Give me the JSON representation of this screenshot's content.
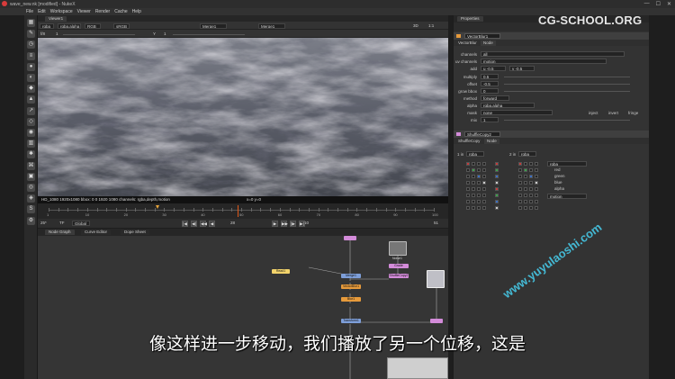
{
  "window": {
    "title": "wave_new.nk [modified] - NukeX",
    "buttons": {
      "minimize": "—",
      "maximize": "☐",
      "close": "✕"
    }
  },
  "menu": [
    "File",
    "Edit",
    "Workspace",
    "Viewer",
    "Render",
    "Cache",
    "Help"
  ],
  "left_toolbar": {
    "icons": [
      "image-icon",
      "draw-icon",
      "time-icon",
      "channel-icon",
      "color-icon",
      "filter-icon",
      "keyer-icon",
      "merge-icon",
      "transform-icon",
      "3d-icon",
      "views-icon",
      "metadata-icon",
      "toolsets-icon",
      "other-icon",
      "furnace-icon",
      "ocula-icon",
      "cara-icon",
      "python-icon",
      "settings-icon"
    ],
    "glyphs": [
      "▦",
      "✎",
      "◷",
      "≡",
      "●",
      "◐",
      "◆",
      "▲",
      "↗",
      "◇",
      "◉",
      "▥",
      "✱",
      "⌘",
      "▣",
      "◎",
      "◈",
      "S",
      "⚙"
    ]
  },
  "viewer": {
    "tab": "Viewer1",
    "bar1": {
      "layer": "rgba",
      "alpha": "rgba.alpha",
      "channel": "RGB",
      "colorspace": "sRGB",
      "input_a": "Merge1",
      "input_b": "Merge1",
      "zoom": "3D",
      "fps": "1:1"
    },
    "bar2": {
      "f": "f/8",
      "gain_value": "1",
      "y": "Y",
      "gamma_value": "1"
    },
    "info": {
      "format": "HD_1080 1920x1080  bbox: 0 0 1920 1080  channels: rgba,depth,motion",
      "coords": "x=0 y=0"
    }
  },
  "timeline": {
    "start": "1",
    "end": "100",
    "labels": [
      "1",
      "10",
      "20",
      "30",
      "40",
      "50",
      "60",
      "70",
      "80",
      "90",
      "100"
    ],
    "current_frame": "28"
  },
  "playback": {
    "fps_label": "25*",
    "tf": "TF",
    "mode": "Global",
    "frame_field": "1",
    "step": "10",
    "end_field": "51",
    "buttons": [
      "|◀",
      "◀|",
      "◀◀",
      "◀",
      "▶",
      "▶▶",
      "|▶",
      "▶|"
    ]
  },
  "nodegraph": {
    "tabs": [
      "Node Graph",
      "Curve Editor",
      "Dope Sheet"
    ],
    "nodes": {
      "read": "Read1",
      "vector": "VectorBlur1",
      "shuffle": "ShuffleCopy2",
      "merge": "Merge1",
      "noise": "Noise1",
      "grade": "Grade",
      "blur": "Blur1",
      "transform": "Transform1"
    }
  },
  "properties": {
    "tab": "Properties",
    "panel1": {
      "name": "VectorBlur1",
      "tabs": [
        "VectorBlur",
        "Node"
      ],
      "knobs": {
        "channels": "all",
        "uv_channels": "motion",
        "uv_label": "uv channels",
        "add_label": "add",
        "add_u": "u -0.5",
        "add_v": "v -0.5",
        "multiply_label": "multiply",
        "multiply": "0.5",
        "offset_label": "offset",
        "offset": "-0.5",
        "grow_bbox_label": "grow bbox",
        "grow_bbox": "0",
        "method_label": "method",
        "method": "forward",
        "alpha_label": "alpha",
        "alpha": "rgba.alpha",
        "mask_label": "mask",
        "mask": "none",
        "mask_extras": [
          "inject",
          "invert",
          "fringe"
        ],
        "mix_label": "mix",
        "mix": "1"
      }
    },
    "panel2": {
      "name": "ShuffleCopy2",
      "tabs": [
        "ShuffleCopy",
        "Node"
      ],
      "in1_label": "1 in",
      "in1": "rgba",
      "in2_label": "2 in",
      "in2": "rgba",
      "out_layer": "rgba",
      "out2_layer": "motion",
      "channels": [
        "red",
        "green",
        "blue",
        "alpha"
      ]
    }
  },
  "watermark": "CG-SCHOOL.ORG",
  "watermark2": "www.yuyulaoshi.com",
  "subtitle": "像这样进一步移动，我们播放了另一个位移，这是"
}
